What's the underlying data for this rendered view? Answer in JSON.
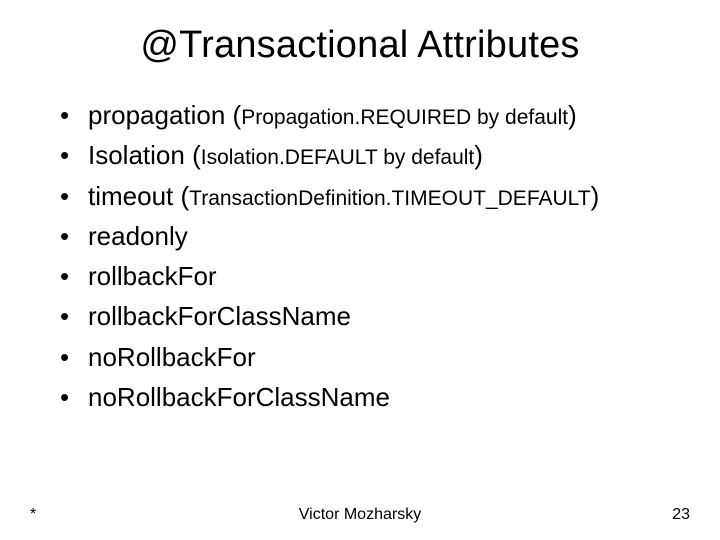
{
  "title": "@Transactional Attributes",
  "items": [
    {
      "main": "propagation (",
      "sub": "Propagation.REQUIRED by default",
      "tail": ")"
    },
    {
      "main": "Isolation (",
      "sub": "Isolation.DEFAULT by default",
      "tail": ")"
    },
    {
      "main": "timeout (",
      "sub": "TransactionDefinition.TIMEOUT_DEFAULT",
      "tail": ")"
    },
    {
      "main": "readonly",
      "sub": "",
      "tail": ""
    },
    {
      "main": "rollbackFor",
      "sub": "",
      "tail": ""
    },
    {
      "main": "rollbackForClassName",
      "sub": "",
      "tail": ""
    },
    {
      "main": "noRollbackFor",
      "sub": "",
      "tail": ""
    },
    {
      "main": "noRollbackForClassName",
      "sub": "",
      "tail": ""
    }
  ],
  "footer": {
    "left": "*",
    "center": "Victor Mozharsky",
    "right": "23"
  }
}
